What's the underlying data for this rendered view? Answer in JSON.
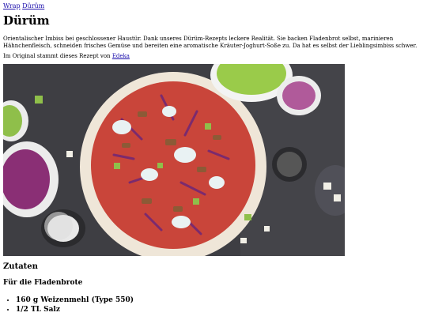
{
  "breadcrumb": {
    "home": "Wrap",
    "current": "Dürüm"
  },
  "title": "Dürüm",
  "intro": "Orientalischer Imbiss bei geschlossener Haustür. Dank unseres Dürüm-Rezepts leckere Realität. Sie backen Fladenbrot selbst, marinieren Hähnchenfleisch, schneiden frisches Gemüse und bereiten eine aromatische Kräuter-Joghurt-Soße zu. Da hat es selbst der Lieblingsimbiss schwer.",
  "source": {
    "prefix": "Im Original stammt dieses Rezept von",
    "link": "Edeka"
  },
  "image": {
    "icon": "recipe-photo"
  },
  "ingredients": {
    "heading": "Zutaten",
    "subheading": "Für die Fladenbrote",
    "items": [
      "160 g Weizenmehl (Type 550)",
      "1/2 TL Salz"
    ]
  },
  "colors": {
    "link": "#1a0dab",
    "photo_bg": "#3e3e43"
  }
}
